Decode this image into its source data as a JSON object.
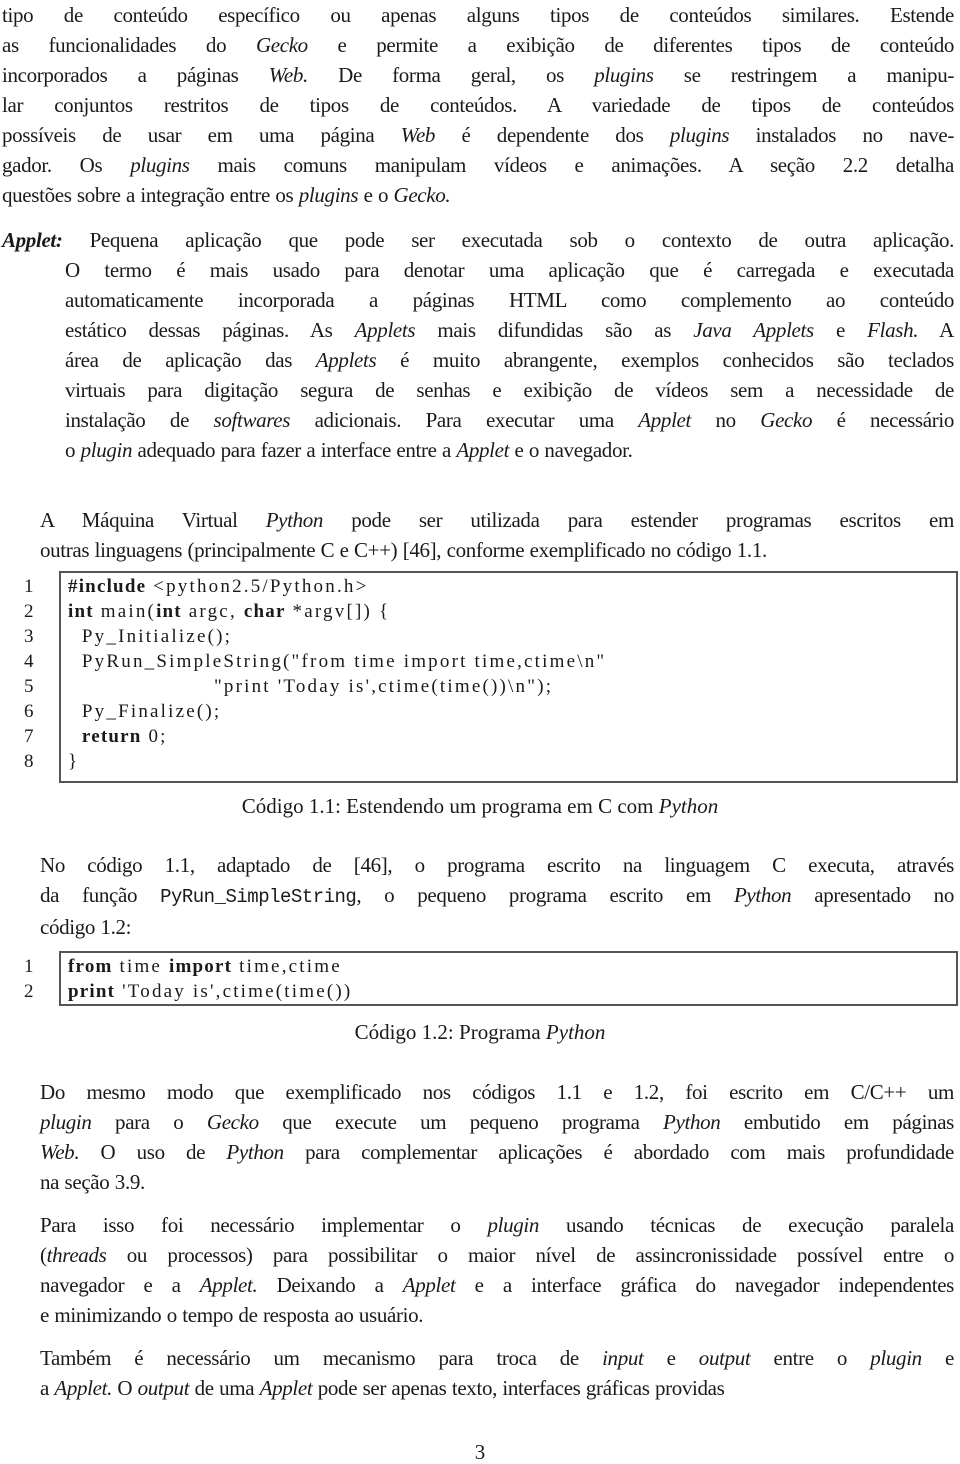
{
  "paragraphs": {
    "p1": {
      "lines": [
        [
          "tipo de conteúdo específico ou apenas alguns tipos de conteúdos similares. Estende"
        ],
        [
          "as funcionalidades do ",
          {
            "i": "Gecko"
          },
          " e permite a exibição de diferentes tipos de conteúdo"
        ],
        [
          "incorporados a páginas ",
          {
            "i": "Web."
          },
          " De forma geral, os ",
          {
            "i": "plugins"
          },
          " se restringem a manipu-"
        ],
        [
          "lar conjuntos restritos de tipos de conteúdos.  A variedade de tipos de conteúdos"
        ],
        [
          "possíveis de usar em uma página ",
          {
            "i": "Web"
          },
          " é dependente dos ",
          {
            "i": "plugins"
          },
          " instalados no nave-"
        ],
        [
          "gador. Os ",
          {
            "i": "plugins"
          },
          " mais comuns manipulam vídeos e animações. A seção 2.2 detalha"
        ],
        [
          "questões sobre a integração entre os ",
          {
            "i": "plugins"
          },
          " e o ",
          {
            "i": "Gecko."
          }
        ]
      ]
    },
    "definition": {
      "term": "Applet:",
      "lines": [
        [
          " Pequena aplicação que pode ser executada sob o contexto de outra aplicação."
        ],
        [
          "O termo é mais usado para denotar uma aplicação que é carregada e executada"
        ],
        [
          "automaticamente incorporada a páginas HTML como complemento ao conteúdo"
        ],
        [
          "estático dessas páginas. As ",
          {
            "i": "Applets"
          },
          " mais difundidas são as ",
          {
            "i": "Java Applets"
          },
          " e ",
          {
            "i": "Flash."
          },
          " A"
        ],
        [
          "área de aplicação das ",
          {
            "i": "Applets"
          },
          " é muito abrangente, exemplos conhecidos são teclados"
        ],
        [
          "virtuais para digitação segura de senhas e exibição de vídeos sem a necessidade de"
        ],
        [
          "instalação de ",
          {
            "i": "softwares"
          },
          " adicionais. Para executar uma ",
          {
            "i": "Applet"
          },
          " no ",
          {
            "i": "Gecko"
          },
          " é necessário"
        ],
        [
          "o ",
          {
            "i": "plugin"
          },
          " adequado para fazer a interface entre a ",
          {
            "i": "Applet"
          },
          " e o navegador."
        ]
      ]
    },
    "p2": {
      "lines": [
        [
          "A Máquina Virtual ",
          {
            "i": "Python"
          },
          " pode ser utilizada para estender programas escritos em"
        ],
        [
          "outras linguagens (principalmente C e C++) [46], conforme exemplificado no código 1.1."
        ]
      ]
    },
    "p3": {
      "lines": [
        [
          "No código 1.1, adaptado de [46], o programa escrito na linguagem C executa, através"
        ],
        [
          "da função ",
          {
            "tt": "PyRun_SimpleString"
          },
          ", o pequeno programa escrito em ",
          {
            "i": "Python"
          },
          " apresentado no"
        ],
        [
          "código 1.2:"
        ]
      ]
    },
    "p4": {
      "lines": [
        [
          "Do mesmo modo que exemplificado nos códigos 1.1 e 1.2, foi escrito em C/C++ um"
        ],
        [
          {
            "i": "plugin"
          },
          " para o ",
          {
            "i": "Gecko"
          },
          " que execute um pequeno programa ",
          {
            "i": "Python"
          },
          " embutido em páginas"
        ],
        [
          {
            "i": "Web."
          },
          " O uso de ",
          {
            "i": "Python"
          },
          " para complementar aplicações é abordado com mais profundidade"
        ],
        [
          "na seção 3.9."
        ]
      ]
    },
    "p5": {
      "lines": [
        [
          "Para isso foi necessário implementar o ",
          {
            "i": "plugin"
          },
          " usando técnicas de execução paralela"
        ],
        [
          "(",
          {
            "i": "threads"
          },
          " ou processos) para possibilitar o maior nível de assincronissidade possível entre o"
        ],
        [
          "navegador e a ",
          {
            "i": "Applet."
          },
          " Deixando a ",
          {
            "i": "Applet"
          },
          " e a interface gráfica do navegador independentes"
        ],
        [
          "e minimizando o tempo de resposta ao usuário."
        ]
      ]
    },
    "p6": {
      "lines": [
        [
          "Também é necessário um mecanismo para troca de ",
          {
            "i": "input"
          },
          " e ",
          {
            "i": "output"
          },
          " entre o ",
          {
            "i": "plugin"
          },
          " e"
        ],
        [
          "a ",
          {
            "i": "Applet."
          },
          "  O ",
          {
            "i": "output"
          },
          " de uma ",
          {
            "i": "Applet"
          },
          " pode ser apenas texto, interfaces gráficas providas"
        ]
      ]
    }
  },
  "code_1_1": {
    "caption": [
      "Código 1.1: Estendendo um programa em C com ",
      {
        "i": "Python"
      }
    ],
    "lines": [
      {
        "n": "1",
        "parts": [
          {
            "b": "#include"
          },
          " <python2.5/Python.h>"
        ]
      },
      {
        "n": "2",
        "parts": [
          {
            "b": "int"
          },
          " main(",
          {
            "b": "int"
          },
          " argc, ",
          {
            "b": "char"
          },
          " *argv[]) {"
        ]
      },
      {
        "n": "3",
        "parts": [
          "  Py_Initialize();"
        ]
      },
      {
        "n": "4",
        "parts": [
          "  PyRun_SimpleString(\"from time import time,ctime\\n\""
        ]
      },
      {
        "n": "5",
        "parts": [
          "                     \"print 'Today is',ctime(time())\\n\");"
        ]
      },
      {
        "n": "6",
        "parts": [
          "  Py_Finalize();"
        ]
      },
      {
        "n": "7",
        "parts": [
          "  ",
          {
            "b": "return"
          },
          " 0;"
        ]
      },
      {
        "n": "8",
        "parts": [
          "}"
        ]
      }
    ]
  },
  "code_1_2": {
    "caption": [
      "Código 1.2: Programa ",
      {
        "i": "Python"
      }
    ],
    "lines": [
      {
        "n": "1",
        "parts": [
          {
            "b": "from"
          },
          " time ",
          {
            "b": "import"
          },
          " time,ctime"
        ]
      },
      {
        "n": "2",
        "parts": [
          {
            "b": "print"
          },
          " 'Today is',ctime(time())"
        ]
      }
    ]
  },
  "page_number": "3"
}
